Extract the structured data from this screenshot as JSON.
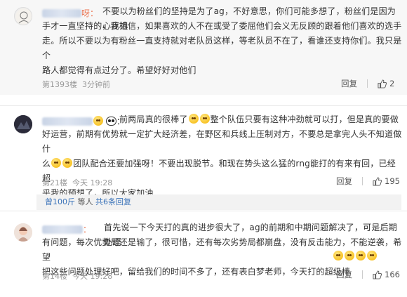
{
  "comments": [
    {
      "username_tail": "呀：",
      "text_lines": [
        "不要以为粉丝们的坚持是为了ag，不好意思，你们可能多想了，粉丝们是因为心疼选",
        "手才一直坚持的，我相信，如果喜欢的人不在或受了委屈他们会义无反顾的跟着他们喜欢的选手",
        "走。所以不要以为有粉丝一直支持就对老队员这样，等老队员不在了，看谁还支持你们。我只是个",
        "路人都觉得有点过分了。希望好好对他们"
      ],
      "floor": "第1393楼",
      "time": "3分钟前",
      "reply_label": "回复",
      "like_count": "2"
    },
    {
      "text_line1": "前两局真的很棒了",
      "text_line1b": "整个队伍只要有这种冲劲就可以打，但是真的要做",
      "text_lines": [
        "好运营，前期有优势就一定扩大经济差，在野区和兵线上压制对方，不要总是拿完人头不知道做什",
        "团队配合还要加强呀！不要出现脱节。和现在势头这么猛的rng能打的有来有回，已经超",
        "乎我的预想了，所以大家加油"
      ],
      "line3_prefix": "么",
      "floor": "第21楼",
      "time": "今天 19:28",
      "reply_label": "回复",
      "like_count": "195",
      "subreplies": {
        "prefix": "曾100斤",
        "middle": " 等人  ",
        "link": "共6条回复"
      }
    },
    {
      "username_tail": "：",
      "text_lines": [
        "首先说一下今天打的真的进步很大了，ag的前期和中期问题解决了，可是后期处理",
        "有问题，每次优势局还是输了，很可惜，还有每次劣势局都崩盘，没有反击能力，不能逆袭，希望",
        "把这些问题处理好吧，留给我们的时间不多了，还有表白梦老师，今天打的超级棒"
      ],
      "floor": "第14楼",
      "time": "今天 19:28",
      "reply_label": "回复",
      "like_count": "166"
    }
  ],
  "icons": {
    "like": "thumbs-up-icon",
    "emoji": "laughing-emoji-icon",
    "panda": "panda-emoji-icon"
  },
  "colors": {
    "name": "#eb7350",
    "link": "#3b73b9",
    "meta": "#999999"
  }
}
